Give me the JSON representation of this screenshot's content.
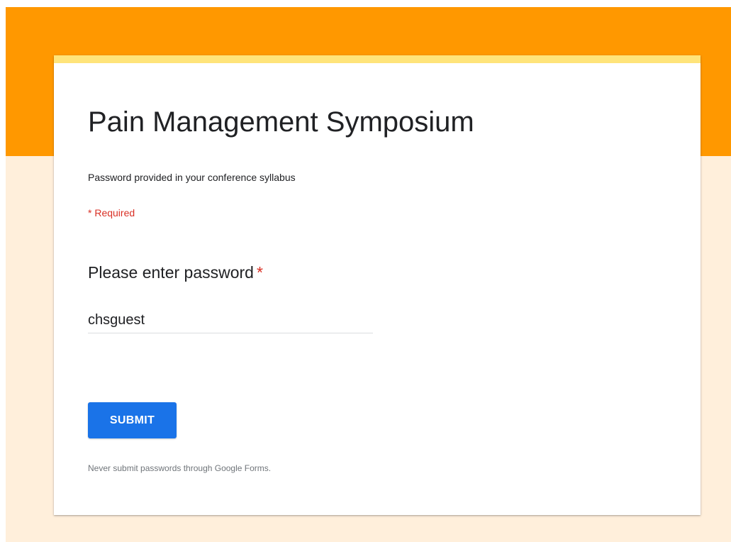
{
  "theme": {
    "header_color": "#ff9800",
    "background_color": "#ffefdb",
    "card_accent_color": "#ffe47a",
    "button_color": "#1a73e8",
    "required_color": "#d93025"
  },
  "form": {
    "title": "Pain Management Symposium",
    "description": "Password provided in your conference syllabus",
    "required_note": "* Required"
  },
  "question": {
    "label": "Please enter password",
    "required_marker": "*",
    "value": "chsguest"
  },
  "actions": {
    "submit_label": "SUBMIT"
  },
  "footer": {
    "note": "Never submit passwords through Google Forms."
  }
}
